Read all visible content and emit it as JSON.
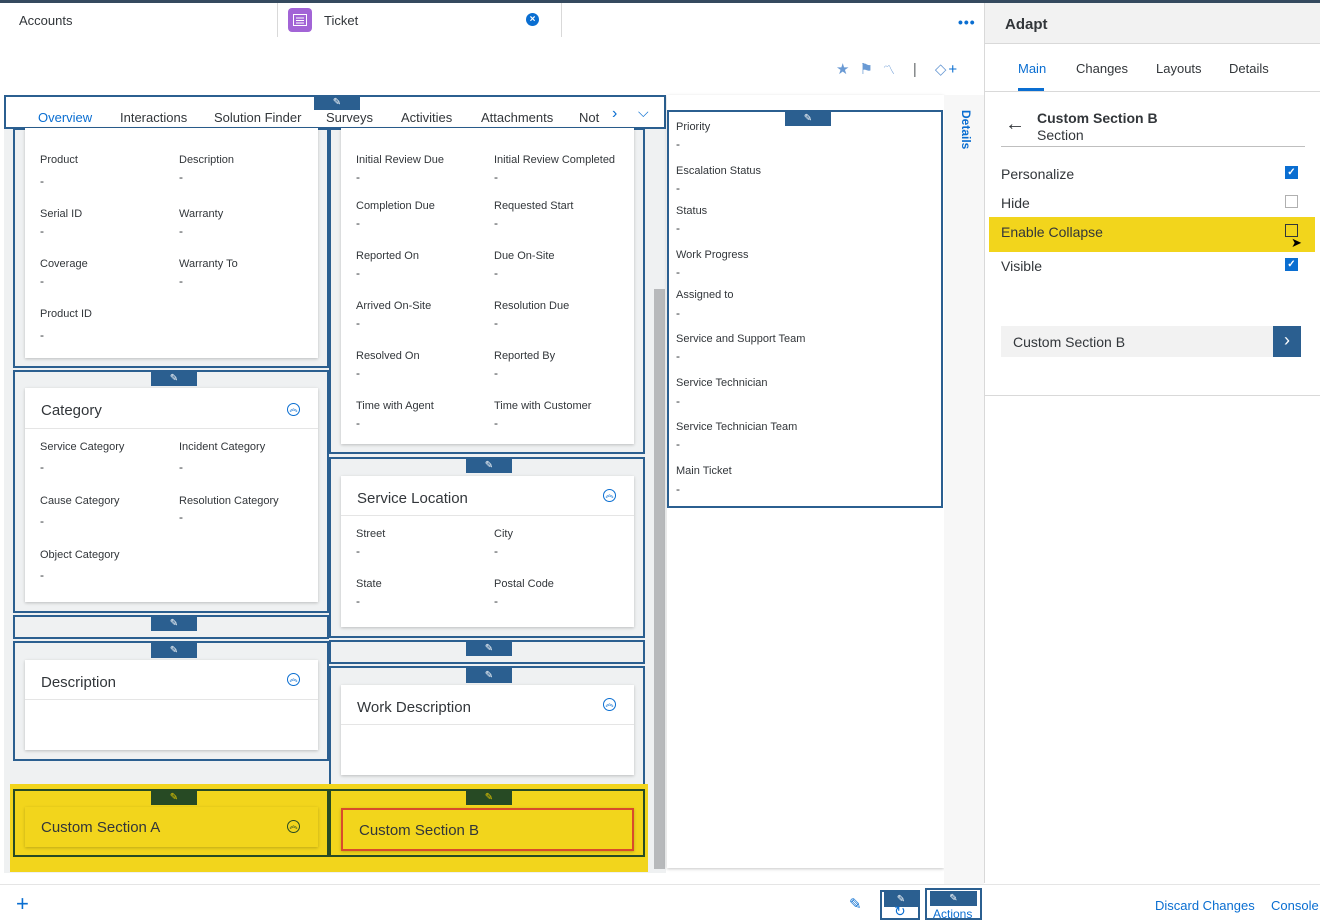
{
  "tabs": {
    "accounts": "Accounts",
    "ticket": "Ticket",
    "ticket_icon": "ticket-icon",
    "close_icon": "close-icon",
    "more_icon": "more-dots-icon"
  },
  "toolbar": {
    "icons": [
      "star-icon",
      "flag-icon",
      "rss-icon",
      "tag-add-icon"
    ],
    "separator": "|",
    "add": "+"
  },
  "section_tabs": {
    "items": [
      "Overview",
      "Interactions",
      "Solution Finder",
      "Surveys",
      "Activities",
      "Attachments",
      "Not"
    ],
    "active": "Overview"
  },
  "details_label": "Details",
  "cards": {
    "product": {
      "fields": [
        {
          "label": "Product",
          "value": "-"
        },
        {
          "label": "Description",
          "value": "-"
        },
        {
          "label": "Serial ID",
          "value": "-"
        },
        {
          "label": "Warranty",
          "value": "-"
        },
        {
          "label": "Coverage",
          "value": "-"
        },
        {
          "label": "Warranty To",
          "value": "-"
        },
        {
          "label": "Product ID",
          "value": "-"
        }
      ]
    },
    "category": {
      "title": "Category",
      "fields": [
        {
          "label": "Service Category",
          "value": "-"
        },
        {
          "label": "Incident Category",
          "value": "-"
        },
        {
          "label": "Cause Category",
          "value": "-"
        },
        {
          "label": "Resolution Category",
          "value": "-"
        },
        {
          "label": "Object Category",
          "value": "-"
        }
      ]
    },
    "description": {
      "title": "Description"
    },
    "custom_a": {
      "title": "Custom Section A"
    },
    "timeline": {
      "fields": [
        {
          "label": "Initial Review Due",
          "value": "-"
        },
        {
          "label": "Initial Review Completed",
          "value": "-"
        },
        {
          "label": "Completion Due",
          "value": "-"
        },
        {
          "label": "Requested Start",
          "value": "-"
        },
        {
          "label": "Reported On",
          "value": "-"
        },
        {
          "label": "Due On-Site",
          "value": "-"
        },
        {
          "label": "Arrived On-Site",
          "value": "-"
        },
        {
          "label": "Resolution Due",
          "value": "-"
        },
        {
          "label": "Resolved On",
          "value": "-"
        },
        {
          "label": "Reported By",
          "value": "-"
        },
        {
          "label": "Time with Agent",
          "value": "-"
        },
        {
          "label": "Time with Customer",
          "value": "-"
        }
      ]
    },
    "service_location": {
      "title": "Service Location",
      "fields": [
        {
          "label": "Street",
          "value": "-"
        },
        {
          "label": "City",
          "value": "-"
        },
        {
          "label": "State",
          "value": "-"
        },
        {
          "label": "Postal Code",
          "value": "-"
        }
      ]
    },
    "work_description": {
      "title": "Work Description"
    },
    "custom_b": {
      "title": "Custom Section B"
    },
    "details": {
      "fields": [
        {
          "label": "Priority",
          "value": "-"
        },
        {
          "label": "Escalation Status",
          "value": "-"
        },
        {
          "label": "Status",
          "value": "-"
        },
        {
          "label": "Work Progress",
          "value": "-"
        },
        {
          "label": "Assigned to",
          "value": "-"
        },
        {
          "label": "Service and Support Team",
          "value": "-"
        },
        {
          "label": "Service Technician",
          "value": "-"
        },
        {
          "label": "Service Technician Team",
          "value": "-"
        },
        {
          "label": "Main Ticket",
          "value": "-"
        }
      ]
    }
  },
  "bottom": {
    "add": "+",
    "actions_label": "Actions",
    "discard": "Discard Changes",
    "console": "Console"
  },
  "adapt": {
    "title": "Adapt",
    "tabs": [
      "Main",
      "Changes",
      "Layouts",
      "Details"
    ],
    "active_tab": "Main",
    "section_name": "Custom Section B",
    "section_type": "Section",
    "options": [
      {
        "label": "Personalize",
        "checked": true
      },
      {
        "label": "Hide",
        "checked": false
      },
      {
        "label": "Enable Collapse",
        "checked": false
      },
      {
        "label": "Visible",
        "checked": true
      }
    ],
    "nav_item": "Custom Section B"
  },
  "colors": {
    "accent": "#0a6ed1",
    "frame": "#2b5f90",
    "highlight": "#f2d51c"
  }
}
